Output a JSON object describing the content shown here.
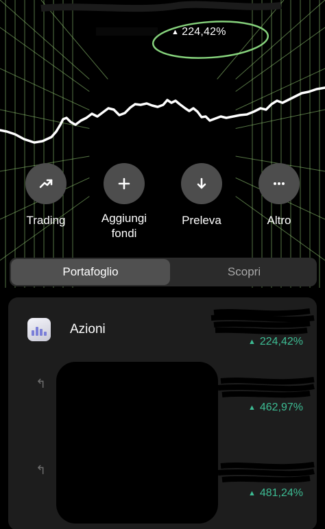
{
  "header": {
    "gain_text": "224,42%",
    "icons": {
      "gain_arrow": "triangle-up"
    }
  },
  "actions": [
    {
      "label": "Trading",
      "icon": "trend-up-icon"
    },
    {
      "label": "Aggiungi\nfondi",
      "icon": "plus-icon"
    },
    {
      "label": "Preleva",
      "icon": "arrow-down-icon"
    },
    {
      "label": "Altro",
      "icon": "more-dots-icon"
    }
  ],
  "tabs": {
    "active": "Portafoglio",
    "other": "Scopri"
  },
  "portfolio": {
    "category_title": "Azioni",
    "category_gain": "224,42%",
    "holdings": [
      {
        "gain": "462,97%"
      },
      {
        "gain": "481,24%"
      }
    ]
  },
  "colors": {
    "gain_green": "#3dbd94",
    "grid_green": "#9bd37a",
    "background": "#000000",
    "card": "#1d1d1d"
  }
}
